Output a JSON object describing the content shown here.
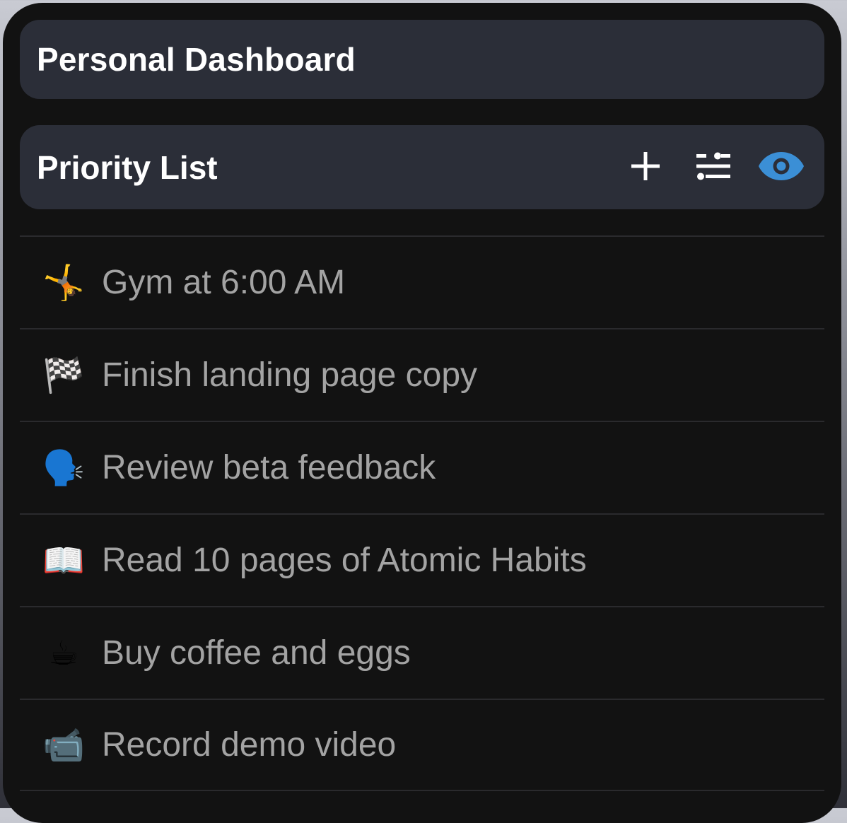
{
  "dashboard": {
    "title": "Personal Dashboard"
  },
  "priority_list": {
    "title": "Priority List",
    "actions": [
      {
        "name": "add-icon",
        "label": "Add"
      },
      {
        "name": "sliders-icon",
        "label": "Filter"
      },
      {
        "name": "eye-icon",
        "label": "View"
      }
    ],
    "accent_color": "#3b8fd6",
    "items": [
      {
        "icon": "🤸",
        "icon_name": "cartwheel-icon",
        "text": "Gym at 6:00 AM"
      },
      {
        "icon": "🏁",
        "icon_name": "checkered-flag-icon",
        "text": "Finish landing page copy"
      },
      {
        "icon": "🗣️",
        "icon_name": "speaking-head-icon",
        "text": "Review beta feedback"
      },
      {
        "icon": "📖",
        "icon_name": "open-book-icon",
        "text": "Read 10 pages of Atomic Habits"
      },
      {
        "icon": "☕",
        "icon_name": "hot-beverage-icon",
        "text": "Buy coffee and eggs"
      },
      {
        "icon": "📹",
        "icon_name": "video-camera-icon",
        "text": "Record demo video"
      }
    ]
  }
}
